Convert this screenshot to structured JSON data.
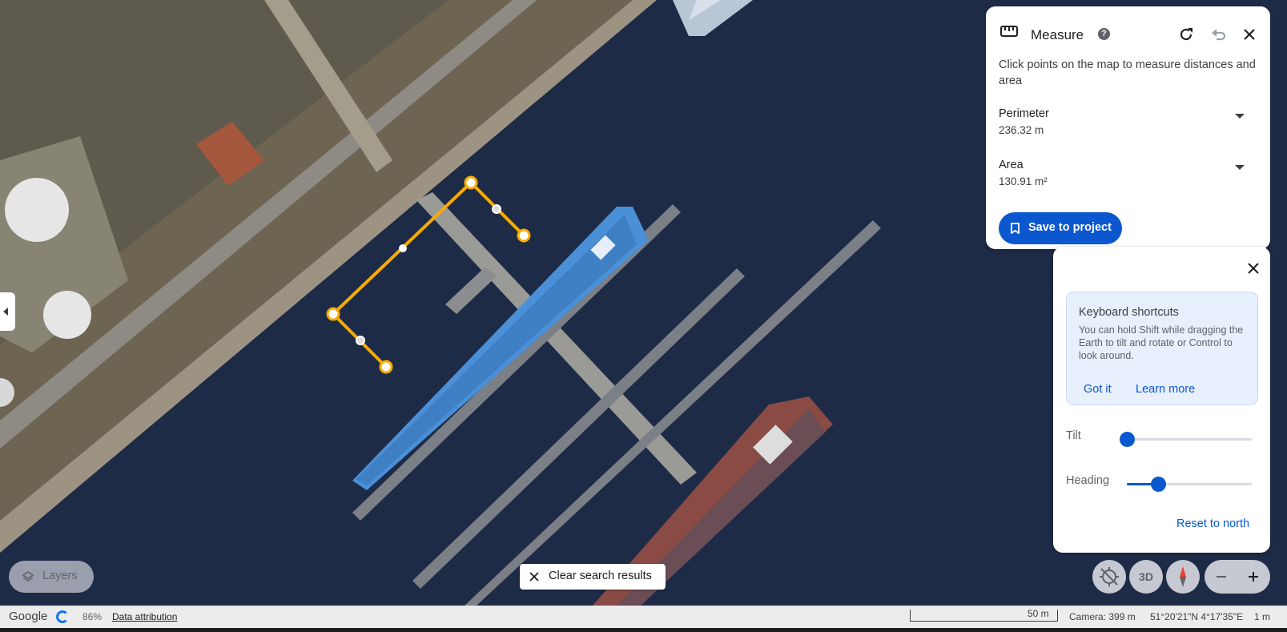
{
  "measure": {
    "title": "Measure",
    "help": "?",
    "description": "Click points on the map to measure distances and area",
    "perimeter_label": "Perimeter",
    "perimeter_value": "236.32 m",
    "area_label": "Area",
    "area_value": "130.91 m²",
    "save_label": "Save to project",
    "icons": [
      "ruler-icon",
      "help-icon",
      "refresh-icon",
      "undo-icon",
      "close-icon",
      "chevron-down-icon",
      "bookmark-icon"
    ]
  },
  "shortcuts": {
    "title": "Keyboard shortcuts",
    "body": "You can hold Shift while dragging the Earth to tilt and rotate or Control to look around.",
    "got_it": "Got it",
    "learn_more": "Learn more"
  },
  "view": {
    "tilt_label": "Tilt",
    "tilt_level": 0,
    "heading_label": "Heading",
    "heading_level": 0.25,
    "reset_label": "Reset to north"
  },
  "controls": {
    "layers_label": "Layers",
    "clear_label": "Clear search results",
    "threed_label": "3D"
  },
  "status": {
    "brand": "Google",
    "loading_pct": "86%",
    "attribution": "Data attribution",
    "scale": "50 m",
    "camera": "Camera: 399 m",
    "coords": "51°20'21\"N 4°17'35\"E",
    "altitude": "1 m"
  },
  "colors": {
    "accent": "#0b57d0",
    "measure_line": "#f9ab00",
    "water": "#1d2a45",
    "land": "#6b6555"
  }
}
